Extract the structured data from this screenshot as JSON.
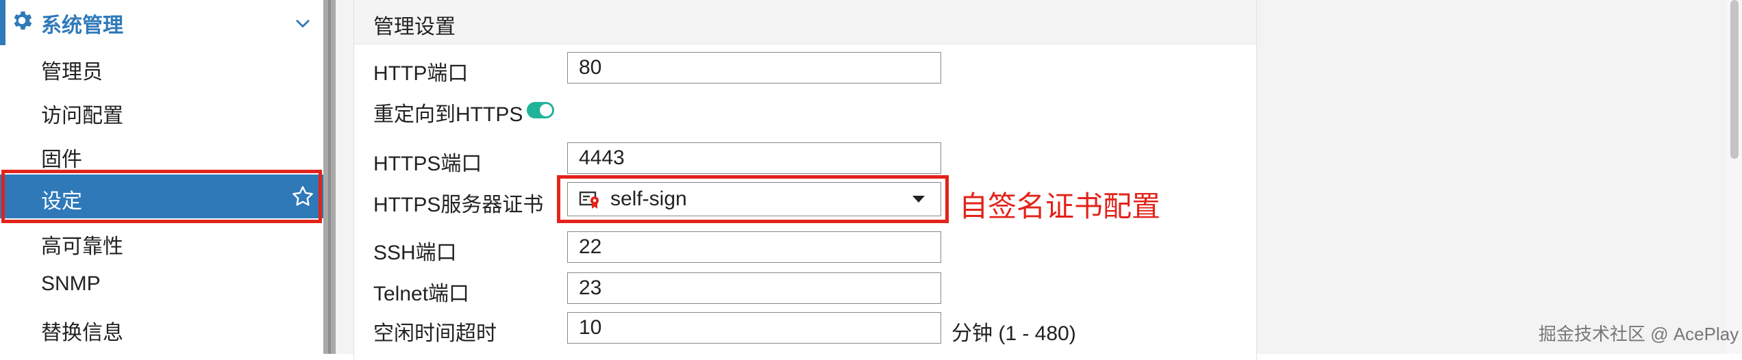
{
  "sidebar": {
    "section_title": "系统管理",
    "items": [
      {
        "label": "管理员"
      },
      {
        "label": "访问配置"
      },
      {
        "label": "固件"
      },
      {
        "label": "设定"
      },
      {
        "label": "高可靠性"
      },
      {
        "label": "SNMP"
      },
      {
        "label": "替换信息"
      }
    ],
    "active_index": 3
  },
  "panel": {
    "title": "管理设置",
    "http_port": {
      "label": "HTTP端口",
      "value": "80"
    },
    "redirect_https": {
      "label": "重定向到HTTPS",
      "enabled": true
    },
    "https_port": {
      "label": "HTTPS端口",
      "value": "4443"
    },
    "https_cert": {
      "label": "HTTPS服务器证书",
      "value": "self-sign"
    },
    "ssh_port": {
      "label": "SSH端口",
      "value": "22"
    },
    "telnet_port": {
      "label": "Telnet端口",
      "value": "23"
    },
    "idle_timeout": {
      "label": "空闲时间超时",
      "value": "10",
      "suffix": "分钟 (1 - 480)"
    }
  },
  "annotation": {
    "text": "自签名证书配置",
    "color": "#e2231a"
  },
  "watermark": "掘金技术社区 @ AcePlay",
  "colors": {
    "accent": "#2f79b9",
    "toggle_on": "#20b39a",
    "highlight": "#e2231a"
  }
}
